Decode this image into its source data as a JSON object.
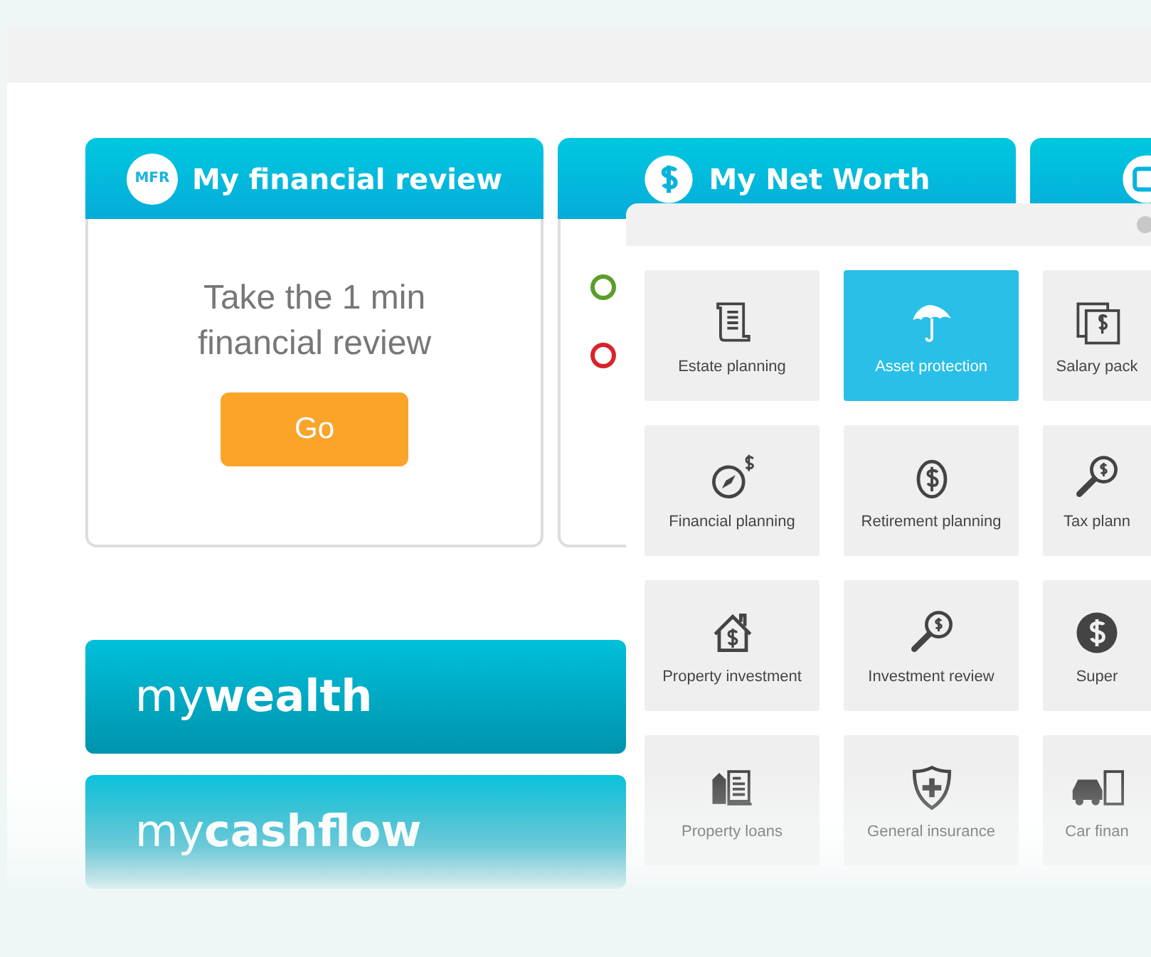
{
  "cards": [
    {
      "kind": "review",
      "badge": "MFR",
      "title": "My financial review",
      "text": "Take the 1 min financial review",
      "button": "Go"
    },
    {
      "kind": "networth",
      "title": "My Net Worth",
      "indicators": [
        {
          "color": "#5a9e2a"
        },
        {
          "color": "#d9232a"
        }
      ]
    },
    {
      "kind": "other"
    }
  ],
  "sections": [
    "my**wealth**",
    "my**cashflow**"
  ],
  "panel": {
    "tiles": [
      {
        "label": "Estate planning",
        "selected": false
      },
      {
        "label": "Asset protection",
        "selected": true
      },
      {
        "label": "Salary pack",
        "selected": false
      },
      {
        "label": "Financial planning",
        "selected": false
      },
      {
        "label": "Retirement planning",
        "selected": false
      },
      {
        "label": "Tax plann",
        "selected": false
      },
      {
        "label": "Property investment",
        "selected": false
      },
      {
        "label": "Investment review",
        "selected": false
      },
      {
        "label": "Super",
        "selected": false
      },
      {
        "label": "Property loans",
        "selected": false
      },
      {
        "label": "General insurance",
        "selected": false
      },
      {
        "label": "Car finan",
        "selected": false
      }
    ]
  }
}
